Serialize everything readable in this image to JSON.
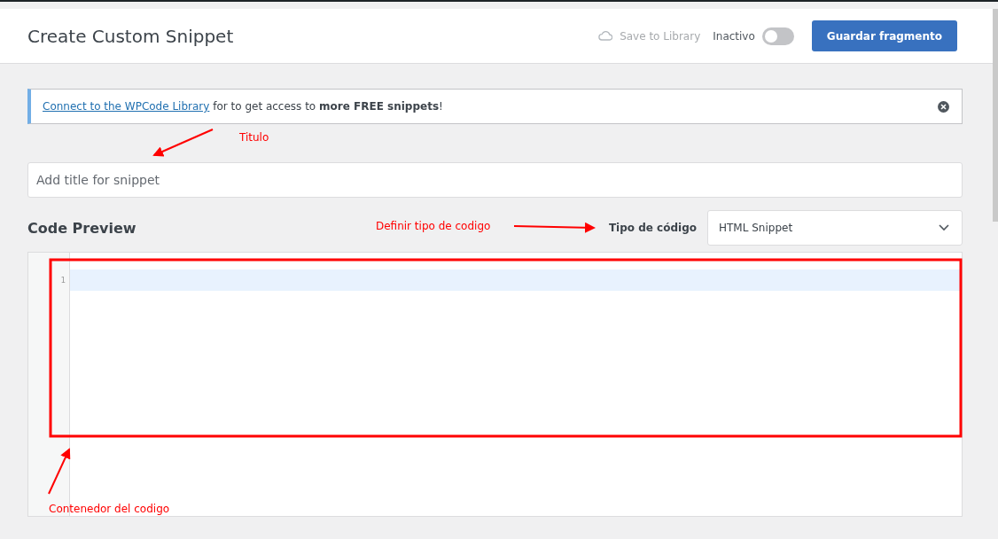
{
  "header": {
    "title": "Create Custom Snippet",
    "save_to_library": "Save to Library",
    "status": {
      "label": "Inactivo",
      "on": false
    },
    "save_button": "Guardar fragmento"
  },
  "notice": {
    "link": "Connect to the WPCode Library",
    "text": " for to get access to **more FREE snippets**!"
  },
  "title_field": {
    "placeholder": "Add title for snippet"
  },
  "code_preview": {
    "heading": "Code Preview",
    "type_label": "Tipo de código",
    "type_value": "HTML Snippet"
  },
  "editor": {
    "line_numbers": [
      "1"
    ]
  },
  "annotations": [
    {
      "text": "Titulo"
    },
    {
      "text": "Definir tipo de codigo"
    },
    {
      "text": "Contenedor del codigo"
    }
  ]
}
